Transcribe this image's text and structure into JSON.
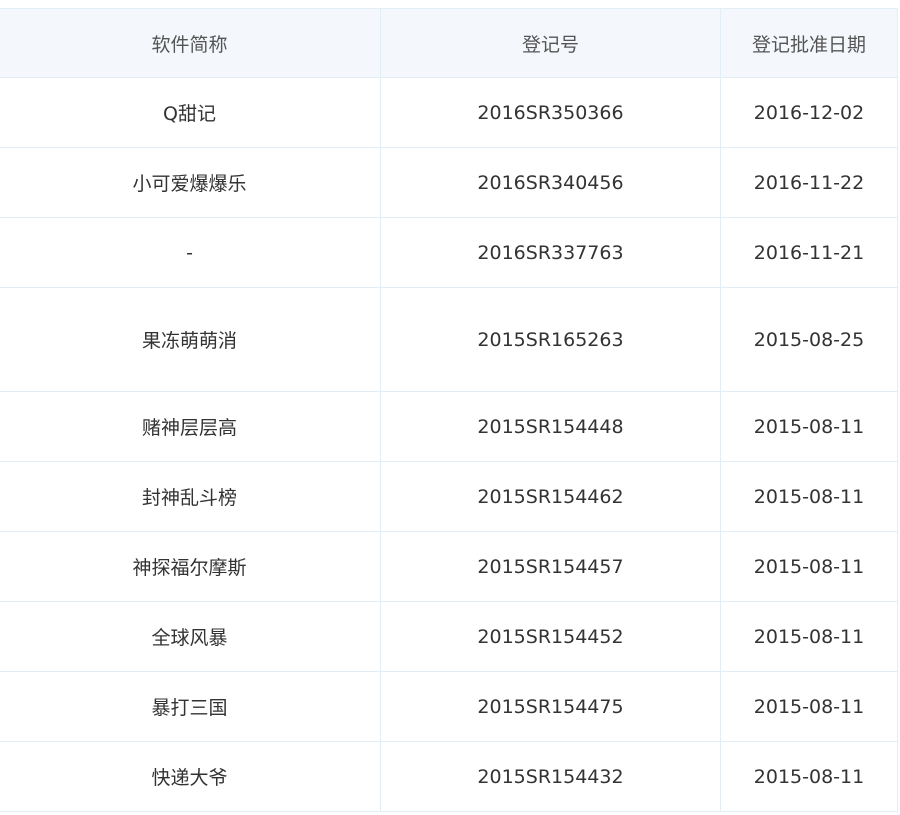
{
  "columns": {
    "name": "软件简称",
    "reg_no": "登记号",
    "date": "登记批准日期"
  },
  "rows": [
    {
      "name": "Q甜记",
      "reg_no": "2016SR350366",
      "date": "2016-12-02"
    },
    {
      "name": "小可爱爆爆乐",
      "reg_no": "2016SR340456",
      "date": "2016-11-22"
    },
    {
      "name": "-",
      "reg_no": "2016SR337763",
      "date": "2016-11-21"
    },
    {
      "name": "果冻萌萌消",
      "reg_no": "2015SR165263",
      "date": "2015-08-25"
    },
    {
      "name": "赌神层层高",
      "reg_no": "2015SR154448",
      "date": "2015-08-11"
    },
    {
      "name": "封神乱斗榜",
      "reg_no": "2015SR154462",
      "date": "2015-08-11"
    },
    {
      "name": "神探福尔摩斯",
      "reg_no": "2015SR154457",
      "date": "2015-08-11"
    },
    {
      "name": "全球风暴",
      "reg_no": "2015SR154452",
      "date": "2015-08-11"
    },
    {
      "name": "暴打三国",
      "reg_no": "2015SR154475",
      "date": "2015-08-11"
    },
    {
      "name": "快递大爷",
      "reg_no": "2015SR154432",
      "date": "2015-08-11"
    }
  ]
}
